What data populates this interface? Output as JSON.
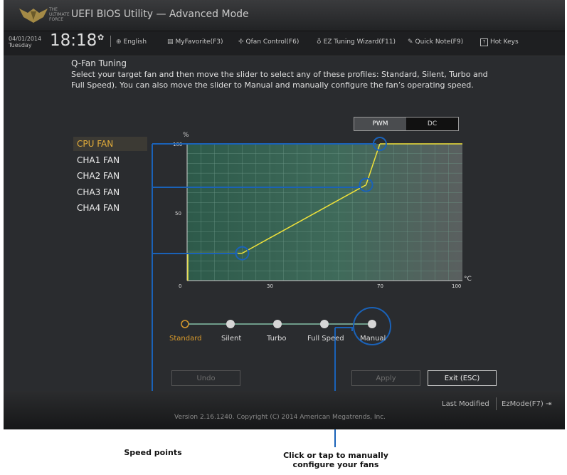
{
  "titlebar": {
    "logo_text": "THE ULTIMATE FORCE",
    "title": "UEFI BIOS Utility — Advanced Mode"
  },
  "status": {
    "date": "04/01/2014",
    "day": "Tuesday",
    "time": "18:18",
    "settings_icon": "gear-icon"
  },
  "menu": {
    "items": [
      {
        "label": "English",
        "icon": "globe-icon"
      },
      {
        "label": "MyFavorite(F3)",
        "icon": "favorites-icon"
      },
      {
        "label": "Qfan Control(F6)",
        "icon": "fan-icon"
      },
      {
        "label": "EZ Tuning Wizard(F11)",
        "icon": "lightbulb-icon"
      },
      {
        "label": "Quick Note(F9)",
        "icon": "note-icon"
      },
      {
        "label": "Hot Keys",
        "icon": "question-icon"
      }
    ]
  },
  "qfan": {
    "title": "Q-Fan Tuning",
    "description": "Select your target fan and then move the slider to select any of these profiles: Standard, Silent, Turbo and Full Speed). You can also move the slider to Manual and manually configure the fan’s operating speed."
  },
  "mode_toggle": {
    "pwm": "PWM",
    "dc": "DC",
    "selected": "PWM"
  },
  "fans": [
    {
      "label": "CPU FAN",
      "selected": true
    },
    {
      "label": "CHA1 FAN",
      "selected": false
    },
    {
      "label": "CHA2 FAN",
      "selected": false
    },
    {
      "label": "CHA3 FAN",
      "selected": false
    },
    {
      "label": "CHA4 FAN",
      "selected": false
    }
  ],
  "chart_data": {
    "type": "line",
    "title": "",
    "ylabel": "%",
    "xlabel": "°C",
    "xlim": [
      0,
      100
    ],
    "ylim": [
      0,
      100
    ],
    "x_ticks": [
      {
        "value": 0,
        "label": "0"
      },
      {
        "value": 30,
        "label": "30"
      },
      {
        "value": 70,
        "label": "70"
      },
      {
        "value": 100,
        "label": "100"
      }
    ],
    "y_ticks": [
      {
        "value": 50,
        "label": "50"
      },
      {
        "value": 100,
        "label": "100"
      }
    ],
    "series": [
      {
        "points": [
          [
            0,
            20
          ],
          [
            20,
            20
          ],
          [
            65,
            70
          ],
          [
            70,
            100
          ],
          [
            100,
            100
          ]
        ]
      }
    ],
    "speed_points": [
      [
        20,
        20
      ],
      [
        65,
        70
      ],
      [
        70,
        100
      ]
    ],
    "line_color": "#f0e23a",
    "grid": true
  },
  "profiles": {
    "items": [
      "Standard",
      "Silent",
      "Turbo",
      "Full Speed",
      "Manual"
    ],
    "selected": "Standard",
    "accent": "#d99a2b"
  },
  "buttons": {
    "undo": "Undo",
    "apply": "Apply",
    "exit": "Exit (ESC)"
  },
  "footer": {
    "version": "Version 2.16.1240. Copyright (C) 2014 American Megatrends, Inc.",
    "last_modified": "Last Modified",
    "ez_mode": "EzMode(F7)"
  },
  "callouts": {
    "speed_points": "Speed points",
    "manual": "Click or tap to manually configure your fans"
  },
  "colors": {
    "highlight_circle": "#1a62b8",
    "accent": "#e5ae3a"
  }
}
